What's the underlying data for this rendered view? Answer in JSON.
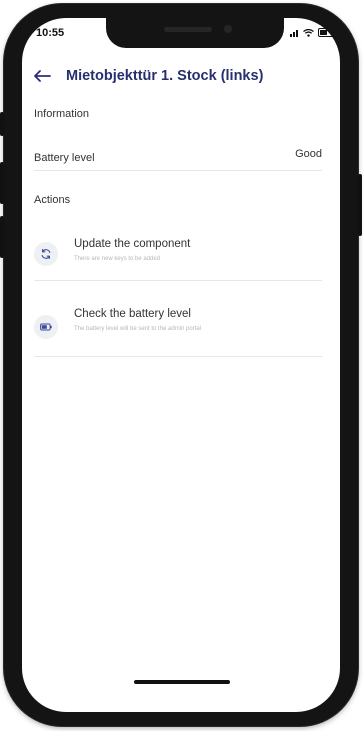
{
  "status_bar": {
    "time": "10:55"
  },
  "header": {
    "back_icon": "arrow-left-icon",
    "title": "Mietobjekttür 1. Stock (links)"
  },
  "information": {
    "section_label": "Information",
    "battery_label": "Battery level",
    "battery_value": "Good"
  },
  "actions": {
    "section_label": "Actions",
    "items": [
      {
        "icon": "refresh-icon",
        "title": "Update the component",
        "subtitle": "There are new keys to be added"
      },
      {
        "icon": "battery-icon",
        "title": "Check the battery level",
        "subtitle": "The battery level will be sent to the admin portal"
      }
    ]
  },
  "colors": {
    "title": "#27306f",
    "icon_accent": "#3b4a9a",
    "icon_bg": "#eef0f4",
    "divider": "#e7e7e7"
  }
}
